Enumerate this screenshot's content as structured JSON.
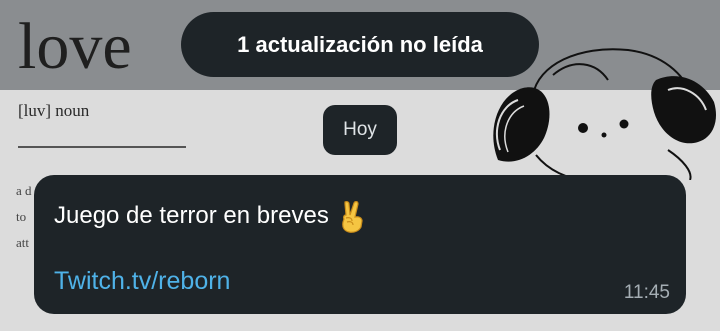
{
  "wallpaper": {
    "word": "love",
    "pronunciation": "[luv] noun",
    "definition_fragments": [
      "a d",
      "to",
      "att"
    ]
  },
  "banner": {
    "label": "1 actualización no leída"
  },
  "date_chip": {
    "label": "Hoy"
  },
  "message": {
    "text": "Juego de terror en breves",
    "emoji_name": "victory-hand-emoji",
    "link": "Twitch.tv/reborn",
    "time": "11:45"
  },
  "colors": {
    "bubble_bg": "#1e2428",
    "link": "#4fb2e8",
    "timestamp": "#a5aeb4"
  }
}
